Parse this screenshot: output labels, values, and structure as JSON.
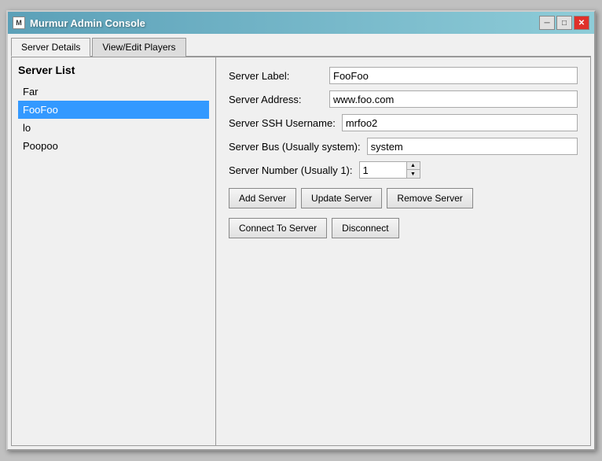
{
  "window": {
    "title": "Murmur Admin Console",
    "icon": "M"
  },
  "title_buttons": {
    "minimize": "─",
    "maximize": "□",
    "close": "✕"
  },
  "tabs": [
    {
      "label": "Server Details",
      "active": true
    },
    {
      "label": "View/Edit Players",
      "active": false
    }
  ],
  "sidebar": {
    "title": "Server List",
    "items": [
      {
        "label": "Far",
        "selected": false
      },
      {
        "label": "FooFoo",
        "selected": true
      },
      {
        "label": "lo",
        "selected": false
      },
      {
        "label": "Poopoo",
        "selected": false
      }
    ]
  },
  "details": {
    "fields": [
      {
        "label": "Server Label:",
        "value": "FooFoo"
      },
      {
        "label": "Server Address:",
        "value": "www.foo.com"
      },
      {
        "label": "Server SSH Username:",
        "value": "mrfoo2"
      },
      {
        "label": "Server Bus (Usually system):",
        "value": "system"
      },
      {
        "label": "Server Number (Usually 1):",
        "value": "1",
        "type": "number"
      }
    ],
    "buttons_row1": [
      {
        "label": "Add Server",
        "name": "add-server-button"
      },
      {
        "label": "Update Server",
        "name": "update-server-button"
      },
      {
        "label": "Remove Server",
        "name": "remove-server-button"
      }
    ],
    "buttons_row2": [
      {
        "label": "Connect To Server",
        "name": "connect-to-server-button"
      },
      {
        "label": "Disconnect",
        "name": "disconnect-button"
      }
    ]
  }
}
